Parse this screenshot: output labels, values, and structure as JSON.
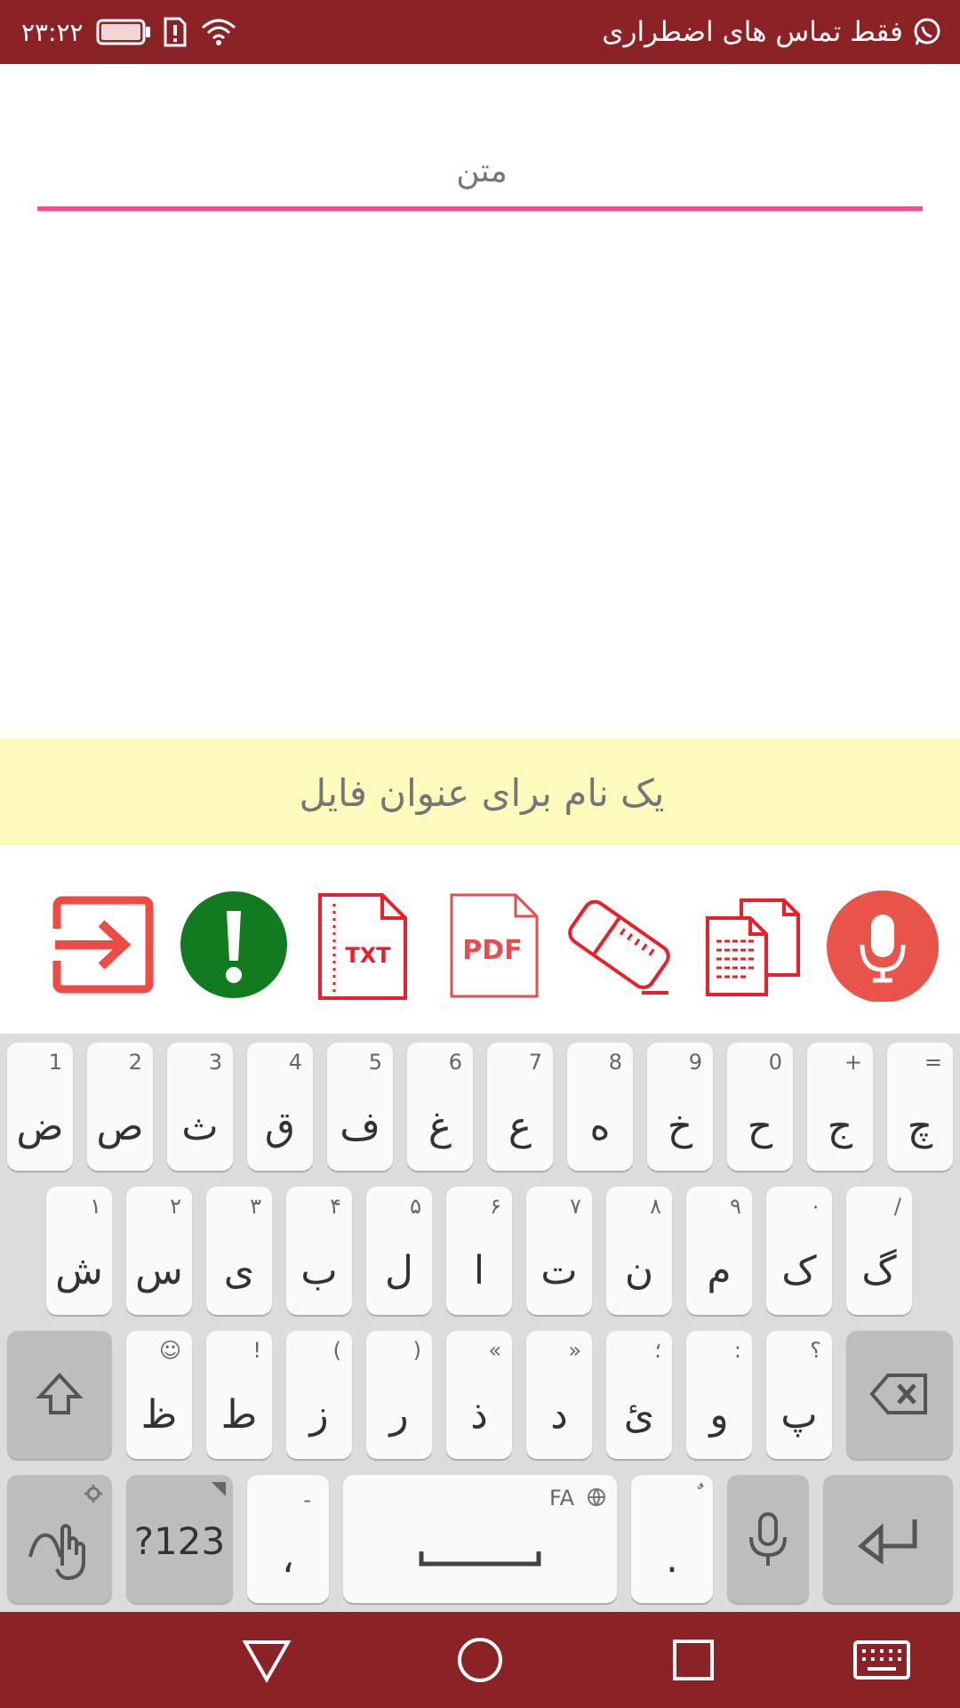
{
  "status_bar": {
    "title": "فقط تماس های اضطراری",
    "time": "۲۳:۲۲"
  },
  "editor": {
    "text_placeholder": "متن",
    "filename_placeholder": "یک نام برای عنوان فایل"
  },
  "toolbar": {
    "icons": [
      "exit-icon",
      "info-icon",
      "txt-file-icon",
      "pdf-file-icon",
      "eraser-icon",
      "copy-icon",
      "microphone-icon"
    ],
    "txt_label": "TXT",
    "pdf_label": "PDF"
  },
  "keyboard": {
    "row1": [
      {
        "main": "ض",
        "hint": "1"
      },
      {
        "main": "ص",
        "hint": "2"
      },
      {
        "main": "ث",
        "hint": "3"
      },
      {
        "main": "ق",
        "hint": "4"
      },
      {
        "main": "ف",
        "hint": "5"
      },
      {
        "main": "غ",
        "hint": "6"
      },
      {
        "main": "ع",
        "hint": "7"
      },
      {
        "main": "ه",
        "hint": "8"
      },
      {
        "main": "خ",
        "hint": "9"
      },
      {
        "main": "ح",
        "hint": "0"
      },
      {
        "main": "ج",
        "hint": "+"
      },
      {
        "main": "چ",
        "hint": "="
      }
    ],
    "row2": [
      {
        "main": "ش",
        "hint": "۱"
      },
      {
        "main": "س",
        "hint": "۲"
      },
      {
        "main": "ی",
        "hint": "۳"
      },
      {
        "main": "ب",
        "hint": "۴"
      },
      {
        "main": "ل",
        "hint": "۵"
      },
      {
        "main": "ا",
        "hint": "۶"
      },
      {
        "main": "ت",
        "hint": "۷"
      },
      {
        "main": "ن",
        "hint": "۸"
      },
      {
        "main": "م",
        "hint": "۹"
      },
      {
        "main": "ک",
        "hint": "۰"
      },
      {
        "main": "گ",
        "hint": "/"
      }
    ],
    "row3": [
      {
        "main": "ظ",
        "hint": "☺"
      },
      {
        "main": "ط",
        "hint": "!"
      },
      {
        "main": "ز",
        "hint": "("
      },
      {
        "main": "ر",
        "hint": ")"
      },
      {
        "main": "ذ",
        "hint": "«"
      },
      {
        "main": "د",
        "hint": "»"
      },
      {
        "main": "ئ",
        "hint": "؛"
      },
      {
        "main": "و",
        "hint": ":"
      },
      {
        "main": "پ",
        "hint": "؟"
      }
    ],
    "symbols_label": "?123",
    "comma_main": "،",
    "comma_hint": "-",
    "space_hint": "FA",
    "period_main": ".",
    "period_hint": "ٌ"
  },
  "colors": {
    "status_bar": "#8b2326",
    "underline": "#f2508c",
    "filename_bg": "#fffbbd",
    "icon_red": "#e8202a",
    "info_green": "#127b1f",
    "mic_red": "#e8534a"
  }
}
